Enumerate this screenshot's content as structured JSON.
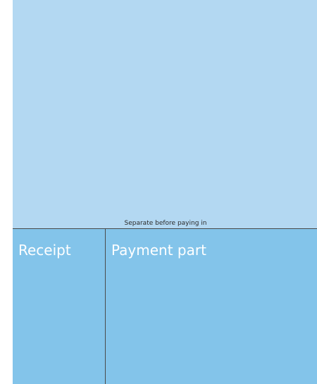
{
  "separator": {
    "text": "Separate before paying in"
  },
  "receipt": {
    "title": "Receipt"
  },
  "payment_part": {
    "title": "Payment part"
  },
  "colors": {
    "upper_background": "#b3d8f2",
    "slip_background": "#83c4ea",
    "text_light": "#ffffff",
    "divider": "#4a4a4a"
  }
}
